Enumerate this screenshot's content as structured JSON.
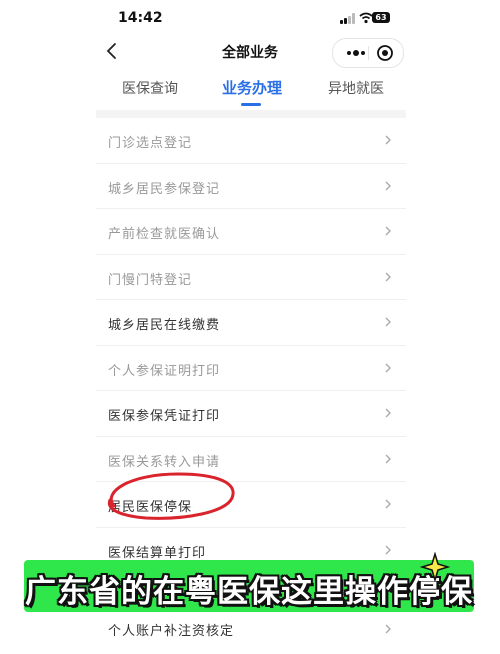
{
  "status_bar": {
    "time": "14:42",
    "battery": "63"
  },
  "header": {
    "title": "全部业务"
  },
  "tabs": [
    {
      "label": "医保查询",
      "active": false
    },
    {
      "label": "业务办理",
      "active": true
    },
    {
      "label": "异地就医",
      "active": false
    }
  ],
  "list": {
    "items": [
      {
        "label": "门诊选点登记",
        "enabled": false
      },
      {
        "label": "城乡居民参保登记",
        "enabled": false
      },
      {
        "label": "产前检查就医确认",
        "enabled": false
      },
      {
        "label": "门慢门特登记",
        "enabled": false
      },
      {
        "label": "城乡居民在线缴费",
        "enabled": true
      },
      {
        "label": "个人参保证明打印",
        "enabled": false
      },
      {
        "label": "医保参保凭证打印",
        "enabled": true
      },
      {
        "label": "医保关系转入申请",
        "enabled": false
      },
      {
        "label": "居民医保停保",
        "enabled": true,
        "highlighted": true
      },
      {
        "label": "医保结算单打印",
        "enabled": true
      },
      {
        "label": "个人账户补注资核定",
        "enabled": true
      }
    ]
  },
  "banner": {
    "text": "广东省的在粤医保这里操作停保",
    "color": "#2fe64b"
  },
  "colors": {
    "accent": "#2a6fe6",
    "annotation": "#d9232d"
  }
}
